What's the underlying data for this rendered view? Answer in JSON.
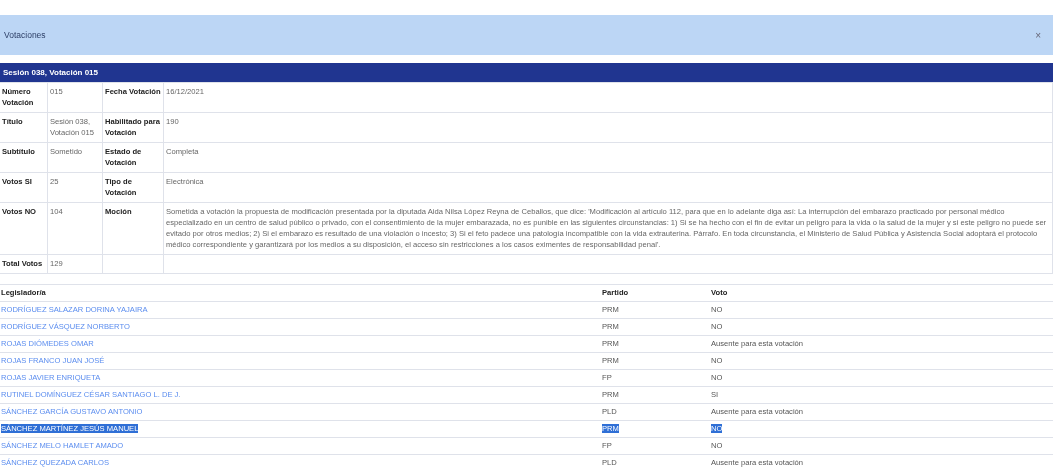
{
  "panel": {
    "title": "Votaciones",
    "close": "×"
  },
  "detail": {
    "title": "Sesión 038, Votación 015",
    "rows": [
      {
        "label_1": "Número Votación",
        "value_1": "015",
        "label_2": "Fecha Votación",
        "value_2": "16/12/2021"
      },
      {
        "label_1": "Título",
        "value_1": "Sesión 038, Votación 015",
        "label_2": "Habilitado para Votación",
        "value_2": "190"
      },
      {
        "label_1": "Subtítulo",
        "value_1": "Sometido",
        "label_2": "Estado de Votación",
        "value_2": "Completa"
      },
      {
        "label_1": "Votos SI",
        "value_1": "25",
        "label_2": "Tipo de Votación",
        "value_2": "Electrónica"
      },
      {
        "label_1": "Votos NO",
        "value_1": "104",
        "label_2": "Moción",
        "value_2": "Sometida a votación la propuesta de modificación presentada por la diputada Aida Nilsa López Reyna de Ceballos, que dice: 'Modificación al artículo 112, para que en lo adelante diga así: La interrupción del embarazo practicado por personal médico especializado en un centro de salud público o privado, con el consentimiento de la mujer embarazada, no es punible en las siguientes circunstancias: 1) Si se ha hecho con el fin de evitar un peligro para la vida o la salud de la mujer y si este peligro no puede ser evitado por otros medios; 2) Si el embarazo es resultado de una violación o incesto; 3) Si el feto padece una patología incompatible con la vida extrauterina. Párrafo. En toda circunstancia, el Ministerio de Salud Pública y Asistencia Social adoptará el protocolo médico correspondiente y garantizará por los medios a su disposición, el acceso sin restricciones a los casos eximentes de responsabilidad penal'."
      },
      {
        "label_1": "Total Votos",
        "value_1": "129"
      }
    ]
  },
  "votes": {
    "columns": [
      "Legislador/a",
      "Partido",
      "Voto"
    ],
    "rows": [
      {
        "name": "RODRÍGUEZ SALAZAR DORINA YAJAIRA",
        "party": "PRM",
        "vote": "NO",
        "selected": false
      },
      {
        "name": "RODRÍGUEZ VÁSQUEZ NORBERTO",
        "party": "PRM",
        "vote": "NO",
        "selected": false
      },
      {
        "name": "ROJAS DIÓMEDES OMAR",
        "party": "PRM",
        "vote": "Ausente para esta votación",
        "selected": false
      },
      {
        "name": "ROJAS FRANCO JUAN JOSÉ",
        "party": "PRM",
        "vote": "NO",
        "selected": false
      },
      {
        "name": "ROJAS JAVIER ENRIQUETA",
        "party": "FP",
        "vote": "NO",
        "selected": false
      },
      {
        "name": "RUTINEL DOMÍNGUEZ CÉSAR SANTIAGO L. DE J.",
        "party": "PRM",
        "vote": "SI",
        "selected": false
      },
      {
        "name": "SÁNCHEZ GARCÍA GUSTAVO ANTONIO",
        "party": "PLD",
        "vote": "Ausente para esta votación",
        "selected": false
      },
      {
        "name": "SÁNCHEZ MARTÍNEZ JESÚS MANUEL",
        "party": "PRM",
        "vote": "NO",
        "selected": true
      },
      {
        "name": "SÁNCHEZ MELO HAMLET AMADO",
        "party": "FP",
        "vote": "NO",
        "selected": false
      },
      {
        "name": "SÁNCHEZ QUEZADA CARLOS",
        "party": "PLD",
        "vote": "Ausente para esta votación",
        "selected": false
      }
    ]
  }
}
